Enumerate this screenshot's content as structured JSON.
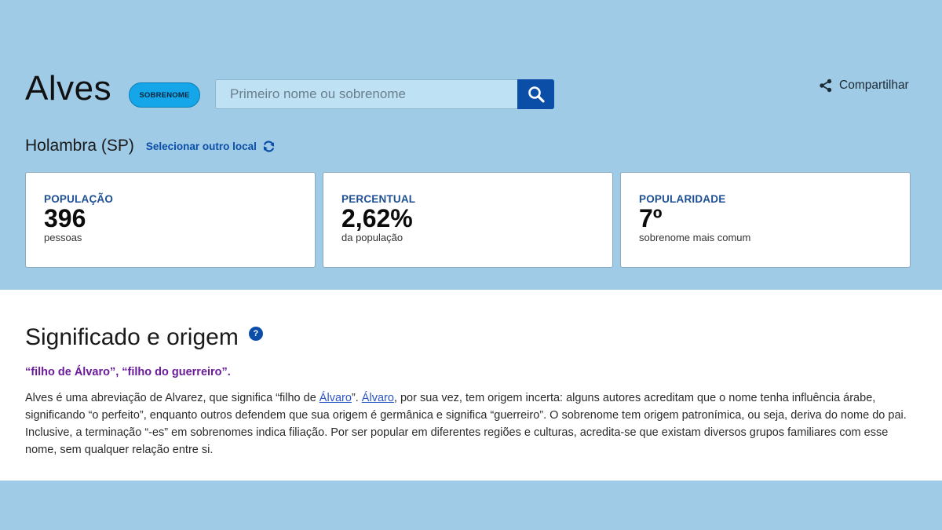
{
  "header": {
    "name": "Alves",
    "badge": "SOBRENOME",
    "search_placeholder": "Primeiro nome ou sobrenome",
    "share_label": "Compartilhar"
  },
  "location": {
    "name": "Holambra (SP)",
    "change_label": "Selecionar outro local"
  },
  "stats": [
    {
      "label": "POPULAÇÃO",
      "value": "396",
      "sub": "pessoas"
    },
    {
      "label": "PERCENTUAL",
      "value": "2,62%",
      "sub": "da população"
    },
    {
      "label": "POPULARIDADE",
      "value": "7º",
      "sub": "sobrenome mais comum"
    }
  ],
  "origin": {
    "title": "Significado e origem",
    "meaning": "“filho de Álvaro”, “filho do guerreiro”.",
    "desc_part1": "Alves é uma abreviação de Alvarez, que significa “filho de ",
    "link1": "Álvaro",
    "desc_part2": "”. ",
    "link2": "Álvaro",
    "desc_part3": ", por sua vez, tem origem incerta: alguns autores acreditam que o nome tenha influência árabe, significando “o perfeito”, enquanto outros defendem que sua origem é germânica e significa “guerreiro”. O sobrenome tem origem patronímica, ou seja, deriva do nome do pai. Inclusive, a terminação “-es” em sobrenomes indica filiação. Por ser popular em diferentes regiões e culturas, acredita-se que existam diversos grupos familiares com esse nome, sem qualquer relação entre si."
  },
  "colors": {
    "background": "#9fcbe6",
    "badge": "#14a6e8",
    "primary": "#0b4ea7",
    "meaning": "#6a1a9a"
  }
}
